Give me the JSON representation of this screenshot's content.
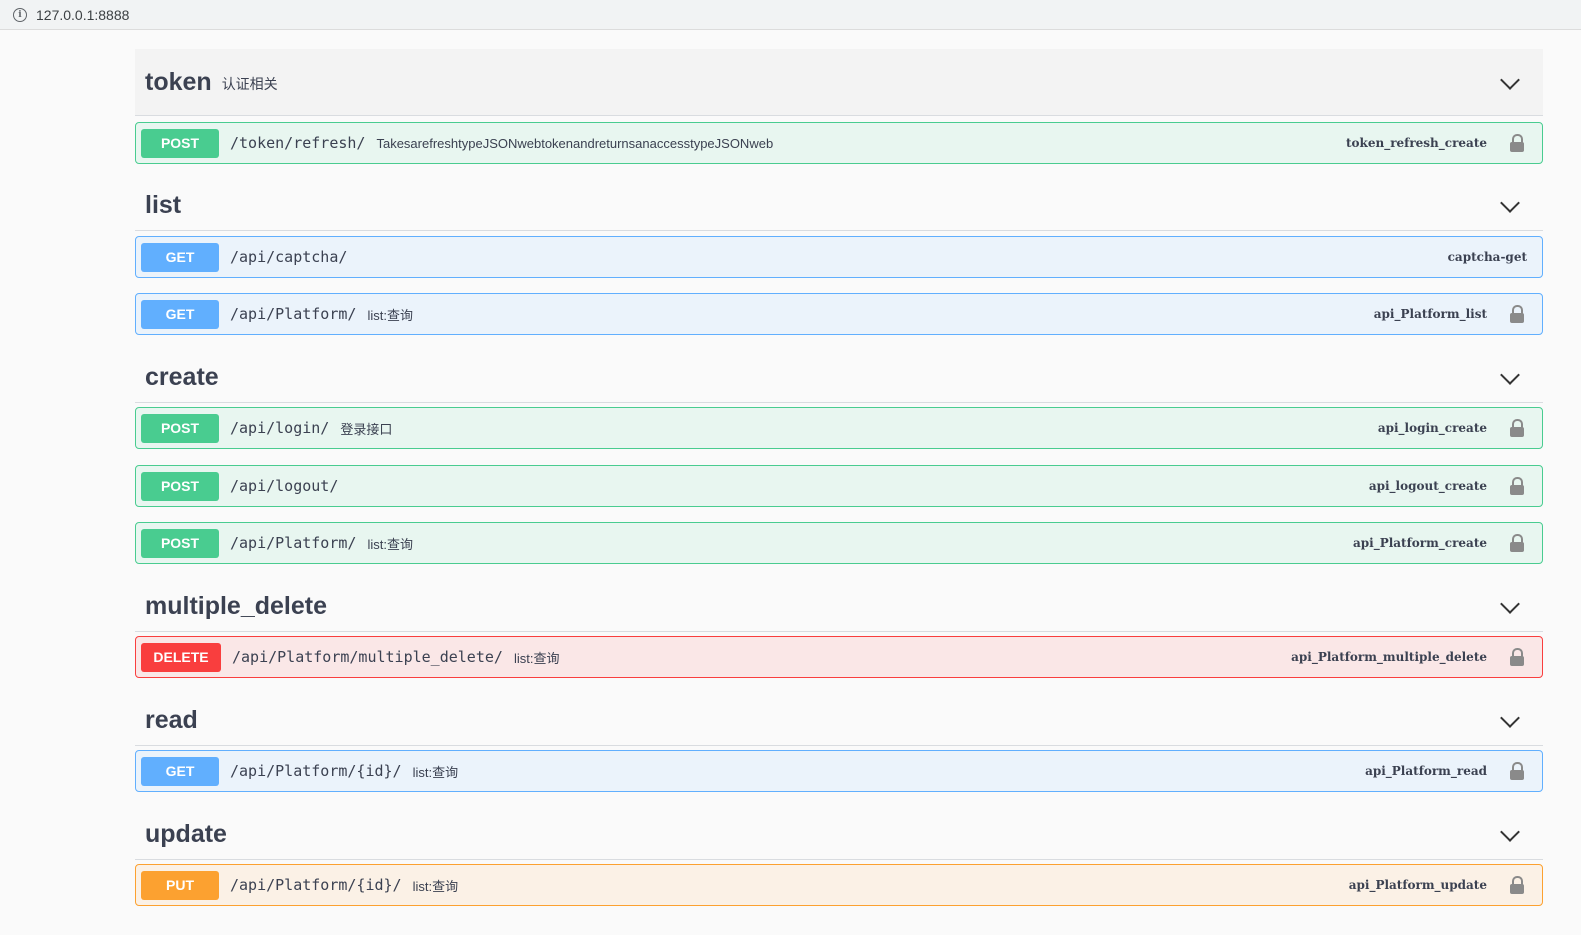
{
  "browser": {
    "url": "127.0.0.1:8888"
  },
  "groups": [
    {
      "name": "token",
      "desc": "认证相关",
      "ops": [
        {
          "method": "POST",
          "path": "/token/refresh/",
          "summary": "TakesarefreshtypeJSONwebtokenandreturnsanaccesstypeJSONweb",
          "id": "token_refresh_create",
          "lock": true
        }
      ]
    },
    {
      "name": "list",
      "desc": "",
      "ops": [
        {
          "method": "GET",
          "path": "/api/captcha/",
          "summary": "",
          "id": "captcha-get",
          "lock": false
        },
        {
          "method": "GET",
          "path": "/api/Platform/",
          "summary": "list:查询",
          "id": "api_Platform_list",
          "lock": true
        }
      ]
    },
    {
      "name": "create",
      "desc": "",
      "ops": [
        {
          "method": "POST",
          "path": "/api/login/",
          "summary": "登录接口",
          "id": "api_login_create",
          "lock": true
        },
        {
          "method": "POST",
          "path": "/api/logout/",
          "summary": "",
          "id": "api_logout_create",
          "lock": true
        },
        {
          "method": "POST",
          "path": "/api/Platform/",
          "summary": "list:查询",
          "id": "api_Platform_create",
          "lock": true
        }
      ]
    },
    {
      "name": "multiple_delete",
      "desc": "",
      "ops": [
        {
          "method": "DELETE",
          "path": "/api/Platform/multiple_delete/",
          "summary": "list:查询",
          "id": "api_Platform_multiple_delete",
          "lock": true
        }
      ]
    },
    {
      "name": "read",
      "desc": "",
      "ops": [
        {
          "method": "GET",
          "path": "/api/Platform/{id}/",
          "summary": "list:查询",
          "id": "api_Platform_read",
          "lock": true
        }
      ]
    },
    {
      "name": "update",
      "desc": "",
      "ops": [
        {
          "method": "PUT",
          "path": "/api/Platform/{id}/",
          "summary": "list:查询",
          "id": "api_Platform_update",
          "lock": true
        }
      ]
    }
  ]
}
